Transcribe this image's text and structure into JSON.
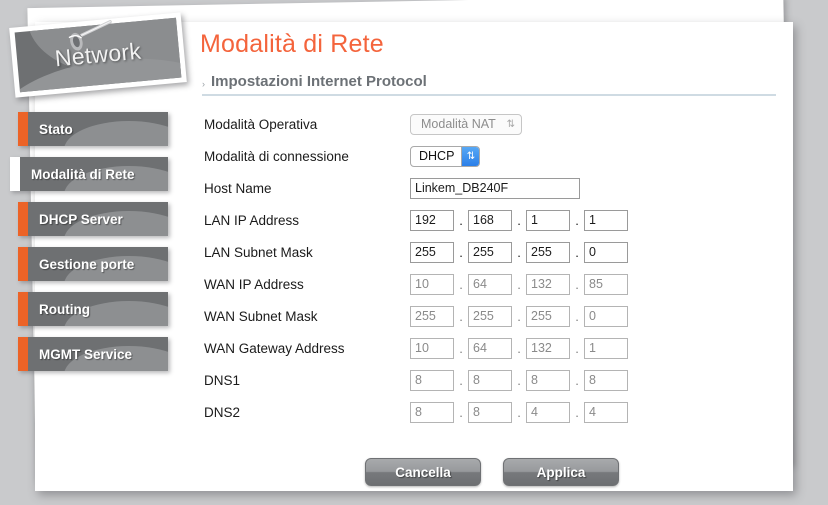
{
  "brand": {
    "logo_label": "Network"
  },
  "sidebar": {
    "items": [
      {
        "label": "Stato",
        "active": false
      },
      {
        "label": "Modalità di Rete",
        "active": true
      },
      {
        "label": "DHCP Server",
        "active": false
      },
      {
        "label": "Gestione porte",
        "active": false
      },
      {
        "label": "Routing",
        "active": false
      },
      {
        "label": "MGMT Service",
        "active": false
      }
    ]
  },
  "main": {
    "page_title": "Modalità di Rete",
    "section_title": "Impostazioni Internet Protocol",
    "section_marker": "›",
    "fields": {
      "op_mode": {
        "label": "Modalità Operativa",
        "value": "Modalità NAT",
        "arrows": "⇅"
      },
      "conn_mode": {
        "label": "Modalità di connessione",
        "value": "DHCP",
        "arrows": "⇅"
      },
      "host_name": {
        "label": "Host Name",
        "value": "Linkem_DB240F"
      },
      "lan_ip": {
        "label": "LAN IP Address",
        "octets": [
          "192",
          "168",
          "1",
          "1"
        ]
      },
      "lan_mask": {
        "label": "LAN Subnet Mask",
        "octets": [
          "255",
          "255",
          "255",
          "0"
        ]
      },
      "wan_ip": {
        "label": "WAN IP Address",
        "octets": [
          "10",
          "64",
          "132",
          "85"
        ]
      },
      "wan_mask": {
        "label": "WAN Subnet Mask",
        "octets": [
          "255",
          "255",
          "255",
          "0"
        ]
      },
      "wan_gw": {
        "label": "WAN Gateway Address",
        "octets": [
          "10",
          "64",
          "132",
          "1"
        ]
      },
      "dns1": {
        "label": "DNS1",
        "octets": [
          "8",
          "8",
          "8",
          "8"
        ]
      },
      "dns2": {
        "label": "DNS2",
        "octets": [
          "8",
          "8",
          "4",
          "4"
        ]
      }
    },
    "separator": "."
  },
  "buttons": {
    "cancel": "Cancella",
    "apply": "Applica"
  },
  "colors": {
    "accent_orange": "#ec6327",
    "title_orange": "#f4643c",
    "nav_gray": "#6e7072",
    "select_blue": "#2b7fe8",
    "page_bg": "#c9cacc"
  }
}
